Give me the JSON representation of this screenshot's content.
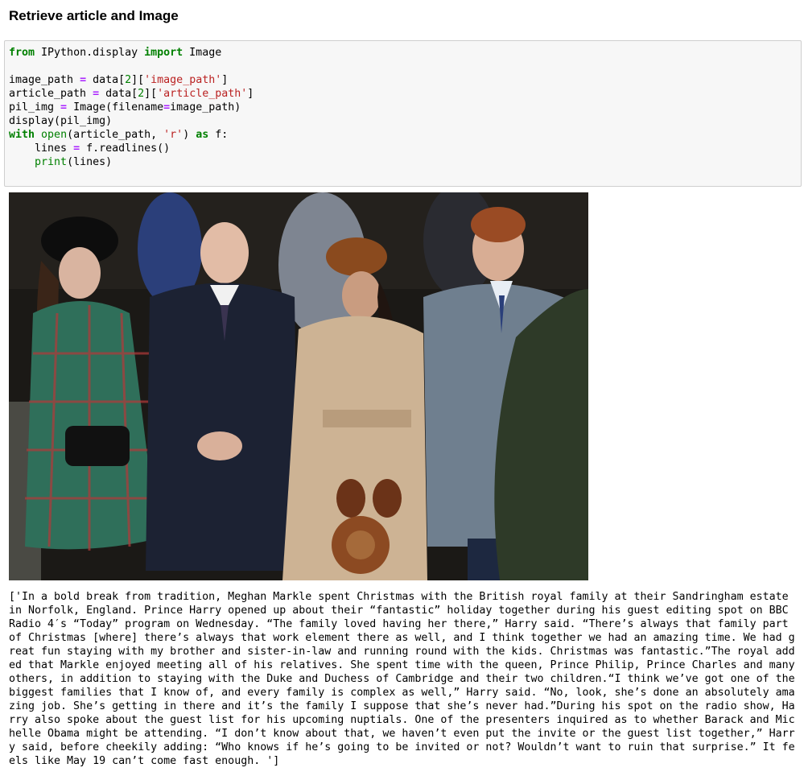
{
  "heading": "Retrieve article and Image",
  "code": {
    "line1": [
      {
        "t": "from",
        "c": "kw"
      },
      {
        "t": " IPython.display ",
        "c": ""
      },
      {
        "t": "import",
        "c": "kw"
      },
      {
        "t": " Image",
        "c": ""
      }
    ],
    "line2": [],
    "line3": [
      {
        "t": "image_path ",
        "c": ""
      },
      {
        "t": "=",
        "c": "op"
      },
      {
        "t": " data[",
        "c": ""
      },
      {
        "t": "2",
        "c": "num"
      },
      {
        "t": "][",
        "c": ""
      },
      {
        "t": "'image_path'",
        "c": "str"
      },
      {
        "t": "]",
        "c": ""
      }
    ],
    "line4": [
      {
        "t": "article_path ",
        "c": ""
      },
      {
        "t": "=",
        "c": "op"
      },
      {
        "t": " data[",
        "c": ""
      },
      {
        "t": "2",
        "c": "num"
      },
      {
        "t": "][",
        "c": ""
      },
      {
        "t": "'article_path'",
        "c": "str"
      },
      {
        "t": "]",
        "c": ""
      }
    ],
    "line5": [
      {
        "t": "pil_img ",
        "c": ""
      },
      {
        "t": "=",
        "c": "op"
      },
      {
        "t": " Image(filename",
        "c": ""
      },
      {
        "t": "=",
        "c": "op"
      },
      {
        "t": "image_path)",
        "c": ""
      }
    ],
    "line6": [
      {
        "t": "display(pil_img)",
        "c": ""
      }
    ],
    "line7": [
      {
        "t": "with",
        "c": "kw"
      },
      {
        "t": " ",
        "c": ""
      },
      {
        "t": "open",
        "c": "bi"
      },
      {
        "t": "(article_path, ",
        "c": ""
      },
      {
        "t": "'r'",
        "c": "str"
      },
      {
        "t": ") ",
        "c": ""
      },
      {
        "t": "as",
        "c": "kw"
      },
      {
        "t": " f:",
        "c": ""
      }
    ],
    "line8": [
      {
        "t": "    lines ",
        "c": ""
      },
      {
        "t": "=",
        "c": "op"
      },
      {
        "t": " f.readlines()",
        "c": ""
      }
    ],
    "line9": [
      {
        "t": "    ",
        "c": ""
      },
      {
        "t": "print",
        "c": "bi"
      },
      {
        "t": "(lines)",
        "c": ""
      }
    ]
  },
  "output_text": "['In a bold break from tradition, Meghan Markle spent Christmas with the British royal family at their Sandringham estate in Norfolk, England. Prince Harry opened up about their “fantastic” holiday together during his guest editing spot on BBC Radio 4′s “Today” program on Wednesday. “The family loved having her there,” Harry said. “There’s always that family part of Christmas [where] there’s always that work element there as well, and I think together we had an amazing time. We had great fun staying with my brother and sister-in-law and running round with the kids. Christmas was fantastic.”The royal added that Markle enjoyed meeting all of his relatives. She spent time with the queen, Prince Philip, Prince Charles and many others, in addition to staying with the Duke and Duchess of Cambridge and their two children.“I think we’ve got one of the biggest families that I know of, and every family is complex as well,” Harry said. “No, look, she’s done an absolutely amazing job. She’s getting in there and it’s the family I suppose that she’s never had.”During his spot on the radio show, Harry also spoke about the guest list for his upcoming nuptials. One of the presenters inquired as to whether Barack and Michelle Obama might be attending. “I don’t know about that, we haven’t even put the invite or the guest list together,” Harry said, before cheekily adding: “Who knows if he’s going to be invited or not? Wouldn’t want to ruin that surprise.” It feels like May 19 can’t come fast enough. ']"
}
